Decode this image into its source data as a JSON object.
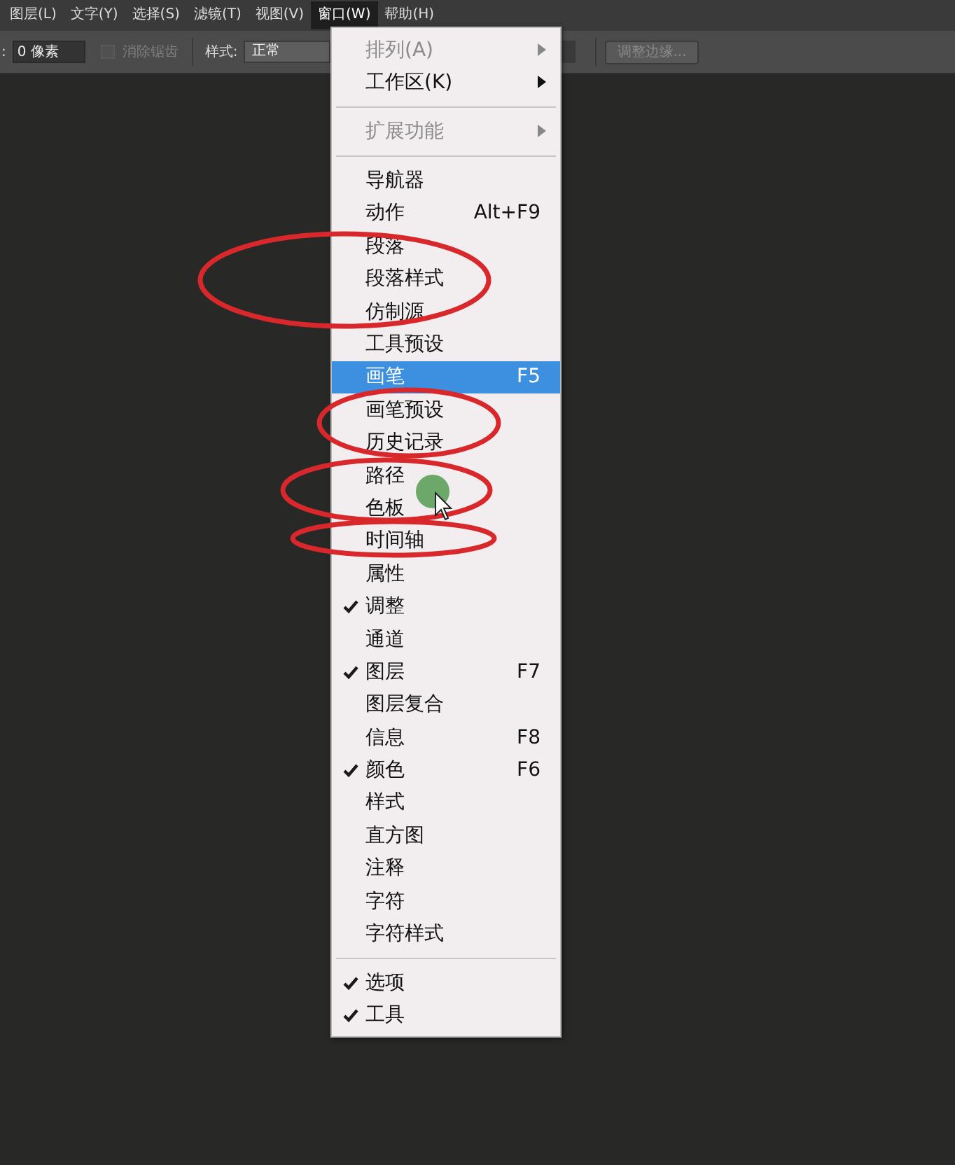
{
  "menubar": [
    {
      "label": "图层(L)",
      "selected": false
    },
    {
      "label": "文字(Y)",
      "selected": false
    },
    {
      "label": "选择(S)",
      "selected": false
    },
    {
      "label": "滤镜(T)",
      "selected": false
    },
    {
      "label": "视图(V)",
      "selected": false
    },
    {
      "label": "窗口(W)",
      "selected": true
    },
    {
      "label": "帮助(H)",
      "selected": false
    }
  ],
  "options_bar": {
    "lead": ":",
    "feather": {
      "value": "0 像素"
    },
    "anti_alias": {
      "label": "消除锯齿",
      "checked": false,
      "disabled": true
    },
    "style": {
      "label": "样式:",
      "value": "正常"
    },
    "refine_button": {
      "label": "调整边缘...",
      "disabled": true
    }
  },
  "window_menu": [
    {
      "kind": "item",
      "label": "排列(A)",
      "disabled": true,
      "submenu": true,
      "selected": false,
      "checked": false
    },
    {
      "kind": "item",
      "label": "工作区(K)",
      "disabled": false,
      "submenu": true,
      "selected": false,
      "checked": false
    },
    {
      "kind": "separator"
    },
    {
      "kind": "item",
      "label": "扩展功能",
      "disabled": true,
      "submenu": true,
      "selected": false,
      "checked": false
    },
    {
      "kind": "separator"
    },
    {
      "kind": "item",
      "label": "导航器",
      "disabled": false,
      "submenu": false,
      "selected": false,
      "checked": false
    },
    {
      "kind": "item",
      "label": "动作",
      "shortcut": "Alt+F9",
      "disabled": false,
      "submenu": false,
      "selected": false,
      "checked": false
    },
    {
      "kind": "item",
      "label": "段落",
      "disabled": false,
      "submenu": false,
      "selected": false,
      "checked": false
    },
    {
      "kind": "item",
      "label": "段落样式",
      "disabled": false,
      "submenu": false,
      "selected": false,
      "checked": false
    },
    {
      "kind": "item",
      "label": "仿制源",
      "disabled": false,
      "submenu": false,
      "selected": false,
      "checked": false
    },
    {
      "kind": "item",
      "label": "工具预设",
      "disabled": false,
      "submenu": false,
      "selected": false,
      "checked": false
    },
    {
      "kind": "item",
      "label": "画笔",
      "shortcut": "F5",
      "disabled": false,
      "submenu": false,
      "selected": true,
      "checked": false
    },
    {
      "kind": "item",
      "label": "画笔预设",
      "disabled": false,
      "submenu": false,
      "selected": false,
      "checked": false
    },
    {
      "kind": "item",
      "label": "历史记录",
      "disabled": false,
      "submenu": false,
      "selected": false,
      "checked": false
    },
    {
      "kind": "item",
      "label": "路径",
      "disabled": false,
      "submenu": false,
      "selected": false,
      "checked": false
    },
    {
      "kind": "item",
      "label": "色板",
      "disabled": false,
      "submenu": false,
      "selected": false,
      "checked": false
    },
    {
      "kind": "item",
      "label": "时间轴",
      "disabled": false,
      "submenu": false,
      "selected": false,
      "checked": false
    },
    {
      "kind": "item",
      "label": "属性",
      "disabled": false,
      "submenu": false,
      "selected": false,
      "checked": false
    },
    {
      "kind": "item",
      "label": "调整",
      "disabled": false,
      "submenu": false,
      "selected": false,
      "checked": true
    },
    {
      "kind": "item",
      "label": "通道",
      "disabled": false,
      "submenu": false,
      "selected": false,
      "checked": false
    },
    {
      "kind": "item",
      "label": "图层",
      "shortcut": "F7",
      "disabled": false,
      "submenu": false,
      "selected": false,
      "checked": true
    },
    {
      "kind": "item",
      "label": "图层复合",
      "disabled": false,
      "submenu": false,
      "selected": false,
      "checked": false
    },
    {
      "kind": "item",
      "label": "信息",
      "shortcut": "F8",
      "disabled": false,
      "submenu": false,
      "selected": false,
      "checked": false
    },
    {
      "kind": "item",
      "label": "颜色",
      "shortcut": "F6",
      "disabled": false,
      "submenu": false,
      "selected": false,
      "checked": true
    },
    {
      "kind": "item",
      "label": "样式",
      "disabled": false,
      "submenu": false,
      "selected": false,
      "checked": false
    },
    {
      "kind": "item",
      "label": "直方图",
      "disabled": false,
      "submenu": false,
      "selected": false,
      "checked": false
    },
    {
      "kind": "item",
      "label": "注释",
      "disabled": false,
      "submenu": false,
      "selected": false,
      "checked": false
    },
    {
      "kind": "item",
      "label": "字符",
      "disabled": false,
      "submenu": false,
      "selected": false,
      "checked": false
    },
    {
      "kind": "item",
      "label": "字符样式",
      "disabled": false,
      "submenu": false,
      "selected": false,
      "checked": false
    },
    {
      "kind": "separator"
    },
    {
      "kind": "item",
      "label": "选项",
      "disabled": false,
      "submenu": false,
      "selected": false,
      "checked": true
    },
    {
      "kind": "item",
      "label": "工具",
      "disabled": false,
      "submenu": false,
      "selected": false,
      "checked": true
    }
  ]
}
